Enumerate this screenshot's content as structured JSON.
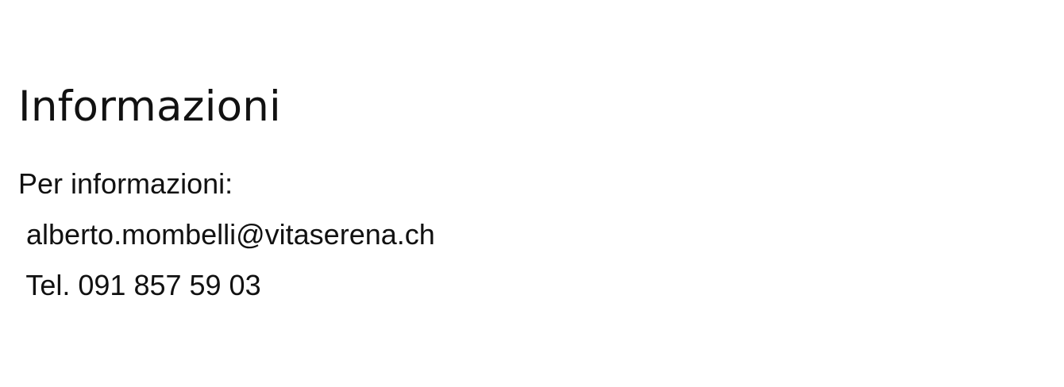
{
  "section": {
    "title": "Informazioni",
    "intro": "Per informazioni:",
    "email": " alberto.mombelli@vitaserena.ch",
    "phone": " Tel. 091 857 59 03"
  }
}
